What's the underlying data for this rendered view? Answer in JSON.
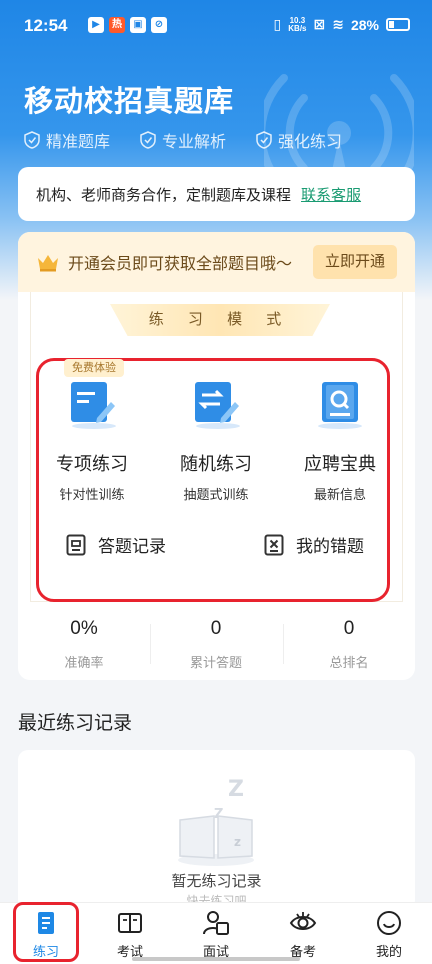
{
  "status_bar": {
    "time": "12:54",
    "net_speed_top": "10.3",
    "net_speed_unit": "KB/s",
    "battery": "28%"
  },
  "header": {
    "title": "移动校招真题库",
    "features": [
      "精准题库",
      "专业解析",
      "强化练习"
    ]
  },
  "business": {
    "text": "机构、老师商务合作，定制题库及课程",
    "link": "联系客服"
  },
  "vip": {
    "text": "开通会员即可获取全部题目哦～",
    "button": "立即开通"
  },
  "practice_mode": {
    "title": "练 习 模 式",
    "free_tag": "免费体验",
    "modes": [
      {
        "title": "专项练习",
        "subtitle": "针对性训练",
        "icon": "edit-doc-icon"
      },
      {
        "title": "随机练习",
        "subtitle": "抽题式训练",
        "icon": "shuffle-doc-icon"
      },
      {
        "title": "应聘宝典",
        "subtitle": "最新信息",
        "icon": "search-book-icon"
      }
    ],
    "record_button": "答题记录",
    "mistakes_button": "我的错题"
  },
  "stats": [
    {
      "value": "0%",
      "label": "准确率"
    },
    {
      "value": "0",
      "label": "累计答题"
    },
    {
      "value": "0",
      "label": "总排名"
    }
  ],
  "recent": {
    "title": "最近练习记录",
    "empty_text": "暂无练习记录",
    "empty_sub": "快去练习吧"
  },
  "tabbar": {
    "items": [
      {
        "label": "练习",
        "icon": "practice-icon",
        "active": true
      },
      {
        "label": "考试",
        "icon": "exam-icon",
        "active": false
      },
      {
        "label": "面试",
        "icon": "interview-icon",
        "active": false
      },
      {
        "label": "备考",
        "icon": "prepare-icon",
        "active": false
      },
      {
        "label": "我的",
        "icon": "profile-icon",
        "active": false
      }
    ]
  },
  "colors": {
    "primary": "#1f86e6",
    "highlight_red": "#e8232e",
    "gold_text": "#6b4a1a",
    "link_green": "#1a9b72"
  }
}
